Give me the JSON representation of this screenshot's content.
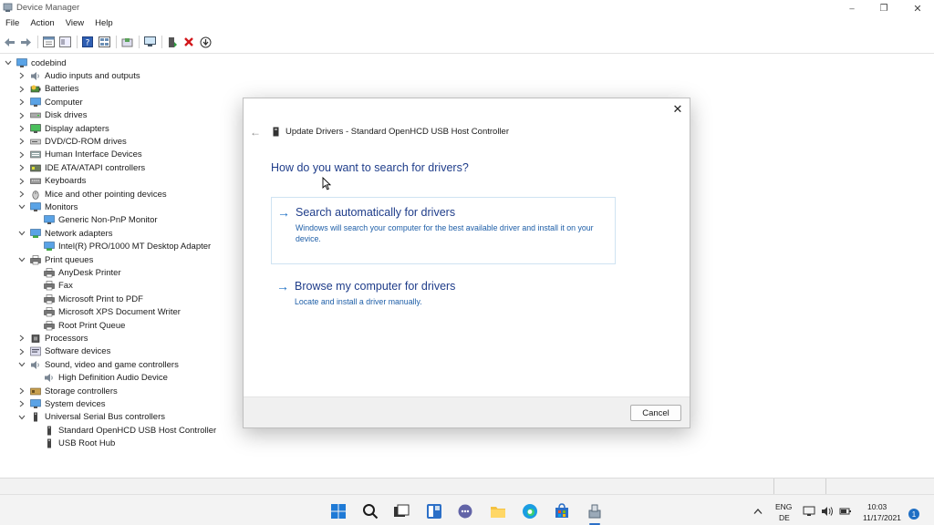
{
  "window": {
    "title": "Device Manager",
    "minimize_glyph": "–",
    "restore_glyph": "❐",
    "close_glyph": "✕"
  },
  "menu": [
    "File",
    "Action",
    "View",
    "Help"
  ],
  "toolbar": {
    "icons": [
      "back-icon",
      "forward-icon",
      "sep",
      "properties-icon",
      "console-icon",
      "sep",
      "help-icon",
      "view-icon",
      "sep",
      "action-icon",
      "sep",
      "monitor-icon",
      "sep",
      "update-driver-icon",
      "uninstall-icon",
      "download-icon"
    ]
  },
  "tree": {
    "root": "codebind",
    "items": [
      {
        "label": "Audio inputs and outputs",
        "level": 1,
        "expanded": false,
        "icon": "speaker-icon"
      },
      {
        "label": "Batteries",
        "level": 1,
        "expanded": false,
        "icon": "battery-icon"
      },
      {
        "label": "Computer",
        "level": 1,
        "expanded": false,
        "icon": "computer-icon"
      },
      {
        "label": "Disk drives",
        "level": 1,
        "expanded": false,
        "icon": "disk-icon"
      },
      {
        "label": "Display adapters",
        "level": 1,
        "expanded": false,
        "icon": "display-icon"
      },
      {
        "label": "DVD/CD-ROM drives",
        "level": 1,
        "expanded": false,
        "icon": "dvd-icon"
      },
      {
        "label": "Human Interface Devices",
        "level": 1,
        "expanded": false,
        "icon": "hid-icon"
      },
      {
        "label": "IDE ATA/ATAPI controllers",
        "level": 1,
        "expanded": false,
        "icon": "ide-icon"
      },
      {
        "label": "Keyboards",
        "level": 1,
        "expanded": false,
        "icon": "keyboard-icon"
      },
      {
        "label": "Mice and other pointing devices",
        "level": 1,
        "expanded": false,
        "icon": "mouse-icon"
      },
      {
        "label": "Monitors",
        "level": 1,
        "expanded": true,
        "icon": "monitor-icon"
      },
      {
        "label": "Generic Non-PnP Monitor",
        "level": 2,
        "icon": "monitor-icon"
      },
      {
        "label": "Network adapters",
        "level": 1,
        "expanded": true,
        "icon": "network-icon"
      },
      {
        "label": "Intel(R) PRO/1000 MT Desktop Adapter",
        "level": 2,
        "icon": "network-icon"
      },
      {
        "label": "Print queues",
        "level": 1,
        "expanded": true,
        "icon": "printer-icon"
      },
      {
        "label": "AnyDesk Printer",
        "level": 2,
        "icon": "printer-icon"
      },
      {
        "label": "Fax",
        "level": 2,
        "icon": "printer-icon"
      },
      {
        "label": "Microsoft Print to PDF",
        "level": 2,
        "icon": "printer-icon"
      },
      {
        "label": "Microsoft XPS Document Writer",
        "level": 2,
        "icon": "printer-icon"
      },
      {
        "label": "Root Print Queue",
        "level": 2,
        "icon": "printer-icon"
      },
      {
        "label": "Processors",
        "level": 1,
        "expanded": false,
        "icon": "processor-icon"
      },
      {
        "label": "Software devices",
        "level": 1,
        "expanded": false,
        "icon": "software-icon"
      },
      {
        "label": "Sound, video and game controllers",
        "level": 1,
        "expanded": true,
        "icon": "speaker-icon"
      },
      {
        "label": "High Definition Audio Device",
        "level": 2,
        "icon": "speaker-icon"
      },
      {
        "label": "Storage controllers",
        "level": 1,
        "expanded": false,
        "icon": "storage-icon"
      },
      {
        "label": "System devices",
        "level": 1,
        "expanded": false,
        "icon": "system-icon"
      },
      {
        "label": "Universal Serial Bus controllers",
        "level": 1,
        "expanded": true,
        "icon": "usb-icon"
      },
      {
        "label": "Standard OpenHCD USB Host Controller",
        "level": 2,
        "icon": "usb-icon"
      },
      {
        "label": "USB Root Hub",
        "level": 2,
        "icon": "usb-icon"
      }
    ]
  },
  "dialog": {
    "title": "Update Drivers - Standard OpenHCD USB Host Controller",
    "question": "How do you want to search for drivers?",
    "option1": {
      "title": "Search automatically for drivers",
      "description": "Windows will search your computer for the best available driver and install it on your device."
    },
    "option2": {
      "title": "Browse my computer for drivers",
      "description": "Locate and install a driver manually."
    },
    "cancel_label": "Cancel",
    "close_glyph": "✕",
    "back_glyph": "←",
    "arrow_glyph": "→"
  },
  "taskbar": {
    "apps": [
      "windows-start-icon",
      "search-icon",
      "task-view-icon",
      "widgets-icon",
      "chat-icon",
      "file-explorer-icon",
      "edge-icon",
      "store-icon",
      "device-manager-icon"
    ],
    "tray": {
      "language_line1": "ENG",
      "language_line2": "DE",
      "time": "10:03",
      "date": "11/17/2021",
      "notification_count": "1"
    }
  },
  "colors": {
    "accent_text": "#1f3d8a",
    "link_blue": "#1d6fc4",
    "option_border": "#cfe3f2"
  }
}
